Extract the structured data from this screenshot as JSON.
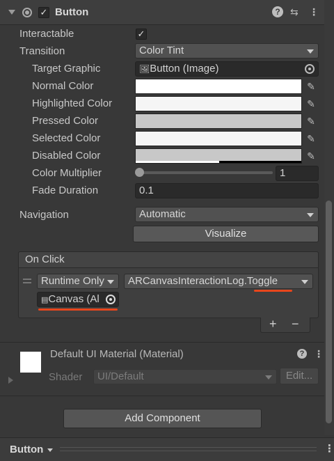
{
  "component": {
    "title": "Button",
    "enabled_check": "✓",
    "fields": {
      "interactable": {
        "label": "Interactable",
        "check": "✓"
      },
      "transition": {
        "label": "Transition",
        "value": "Color Tint"
      },
      "target_graphic": {
        "label": "Target Graphic",
        "value": "Button (Image)"
      },
      "normal_color": {
        "label": "Normal Color",
        "color": "#ffffff"
      },
      "highlighted_color": {
        "label": "Highlighted Color",
        "color": "#f5f5f5"
      },
      "pressed_color": {
        "label": "Pressed Color",
        "color": "#c8c8c8"
      },
      "selected_color": {
        "label": "Selected Color",
        "color": "#f5f5f5"
      },
      "disabled_color": {
        "label": "Disabled Color",
        "color": "#c8c8c8"
      },
      "color_multiplier": {
        "label": "Color Multiplier",
        "value": "1",
        "slider_fraction": 0.0
      },
      "fade_duration": {
        "label": "Fade Duration",
        "value": "0.1"
      },
      "navigation": {
        "label": "Navigation",
        "value": "Automatic"
      }
    },
    "visualize_label": "Visualize",
    "on_click": {
      "header": "On Click",
      "runtime": "Runtime Only",
      "function": "ARCanvasInteractionLog.Toggle",
      "object": "Canvas (Al",
      "add": "+",
      "remove": "−"
    }
  },
  "material": {
    "title": "Default UI Material (Material)",
    "shader_label": "Shader",
    "shader_value": "UI/Default",
    "edit_label": "Edit..."
  },
  "add_component_label": "Add Component",
  "footer": {
    "label": "Button"
  },
  "colors": {
    "accent_underline": "#e8461c",
    "panel_bg": "#383838"
  }
}
